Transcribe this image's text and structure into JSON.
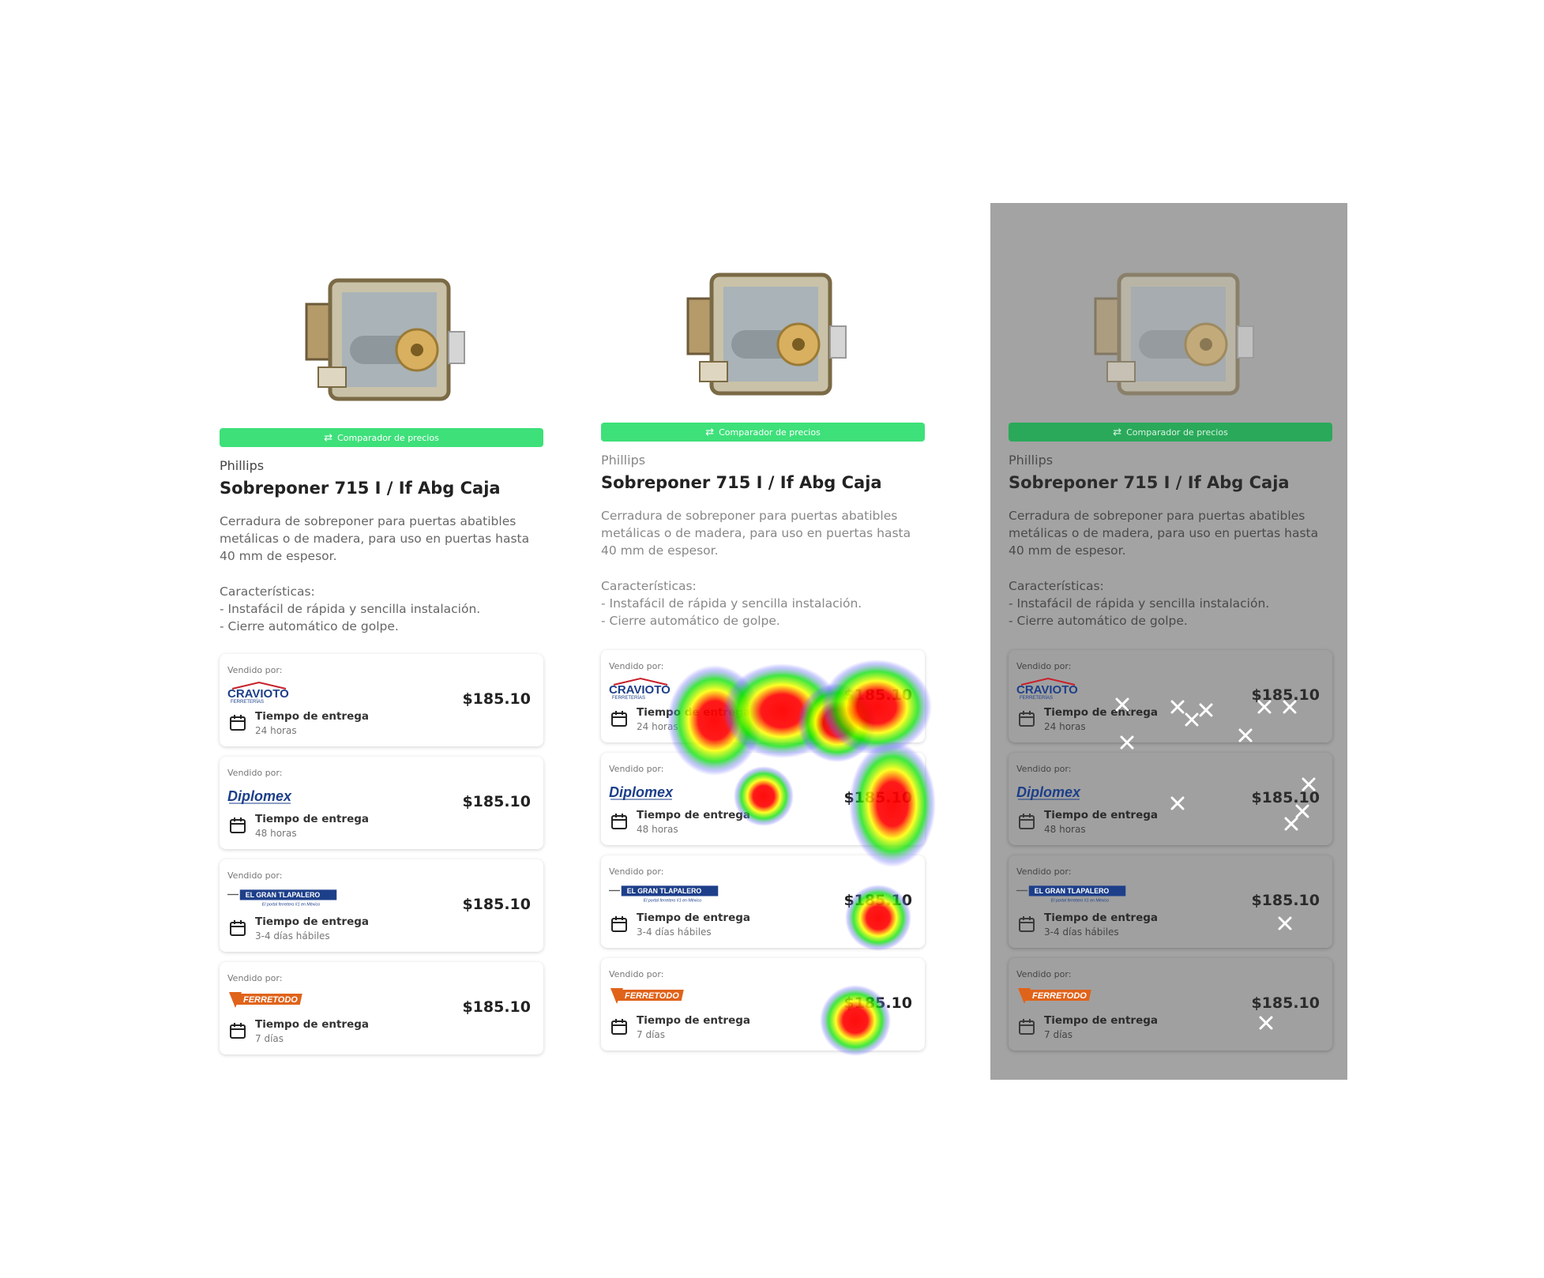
{
  "panels": [
    {
      "id": "original"
    },
    {
      "id": "heatmap"
    },
    {
      "id": "gaze-points"
    }
  ],
  "product": {
    "compare_label": "Comparador de precios",
    "brand": "Phillips",
    "title": "Sobreponer 715 I / If Abg Caja",
    "description": "Cerradura de sobreponer para puertas  abatibles metálicas o de madera, para uso en puertas hasta 40 mm de espesor.",
    "features_heading": "Características:",
    "features": [
      "- Instafácil de rápida y sencilla instalación.",
      "- Cierre automático de golpe."
    ]
  },
  "sold_by_label": "Vendido por:",
  "delivery_label": "Tiempo de entrega",
  "sellers": [
    {
      "name": "Cravioto Ferreterías",
      "logo_text": "CRAVIOTO",
      "logo_sub": "FERRETERÍAS",
      "price": "$185.10",
      "delivery": "24 horas",
      "color": "#1d3f8a"
    },
    {
      "name": "Diplomex",
      "logo_text": "Diplomex",
      "logo_sub": "",
      "price": "$185.10",
      "delivery": "48 horas",
      "color": "#1d3f8a"
    },
    {
      "name": "El Gran Tlapalero",
      "logo_text": "EL GRAN TLAPALERO",
      "logo_sub": "El portal ferretero #1 en México",
      "price": "$185.10",
      "delivery": "3-4 días hábiles",
      "color": "#1d3f8a"
    },
    {
      "name": "Ferretodo",
      "logo_text": "FERRETODO",
      "logo_sub": "",
      "price": "$185.10",
      "delivery": "7 días",
      "color": "#e0631a"
    }
  ],
  "colors": {
    "compare_bar": "#3ee07a",
    "heat_hot": "#ff0000",
    "heat_mid": "#ffff00",
    "heat_cool": "#00ff00",
    "heat_edge": "#6a6aff",
    "gaze_marker": "#ffffff",
    "shade": "#a3a3a3"
  }
}
